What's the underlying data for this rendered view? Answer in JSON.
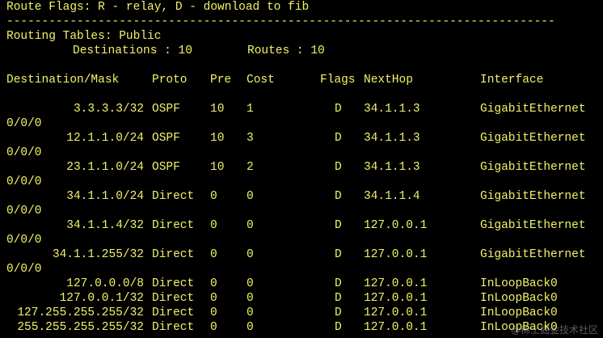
{
  "header": {
    "flags_line": "Route Flags: R - relay, D - download to fib",
    "separator": "------------------------------------------------------------------------------",
    "routing_tables": "Routing Tables: Public",
    "destinations_label": "Destinations : 10",
    "routes_label": "Routes : 10"
  },
  "columns": {
    "destination": "Destination/Mask",
    "proto": "Proto",
    "pre": "Pre",
    "cost": "Cost",
    "flags": "Flags",
    "nexthop": "NextHop",
    "interface": "Interface"
  },
  "routes": [
    {
      "dest": "3.3.3.3/32",
      "proto": "OSPF",
      "pre": "10",
      "cost": "1",
      "flags": "D",
      "nexthop": "34.1.1.3",
      "iface": "GigabitEthernet",
      "iface_cont": "0/0/0"
    },
    {
      "dest": "12.1.1.0/24",
      "proto": "OSPF",
      "pre": "10",
      "cost": "3",
      "flags": "D",
      "nexthop": "34.1.1.3",
      "iface": "GigabitEthernet",
      "iface_cont": "0/0/0"
    },
    {
      "dest": "23.1.1.0/24",
      "proto": "OSPF",
      "pre": "10",
      "cost": "2",
      "flags": "D",
      "nexthop": "34.1.1.3",
      "iface": "GigabitEthernet",
      "iface_cont": "0/0/0"
    },
    {
      "dest": "34.1.1.0/24",
      "proto": "Direct",
      "pre": "0",
      "cost": "0",
      "flags": "D",
      "nexthop": "34.1.1.4",
      "iface": "GigabitEthernet",
      "iface_cont": "0/0/0"
    },
    {
      "dest": "34.1.1.4/32",
      "proto": "Direct",
      "pre": "0",
      "cost": "0",
      "flags": "D",
      "nexthop": "127.0.0.1",
      "iface": "GigabitEthernet",
      "iface_cont": "0/0/0"
    },
    {
      "dest": "34.1.1.255/32",
      "proto": "Direct",
      "pre": "0",
      "cost": "0",
      "flags": "D",
      "nexthop": "127.0.0.1",
      "iface": "GigabitEthernet",
      "iface_cont": "0/0/0"
    },
    {
      "dest": "127.0.0.0/8",
      "proto": "Direct",
      "pre": "0",
      "cost": "0",
      "flags": "D",
      "nexthop": "127.0.0.1",
      "iface": "InLoopBack0",
      "iface_cont": ""
    },
    {
      "dest": "127.0.0.1/32",
      "proto": "Direct",
      "pre": "0",
      "cost": "0",
      "flags": "D",
      "nexthop": "127.0.0.1",
      "iface": "InLoopBack0",
      "iface_cont": ""
    },
    {
      "dest": "127.255.255.255/32",
      "proto": "Direct",
      "pre": "0",
      "cost": "0",
      "flags": "D",
      "nexthop": "127.0.0.1",
      "iface": "InLoopBack0",
      "iface_cont": ""
    },
    {
      "dest": "255.255.255.255/32",
      "proto": "Direct",
      "pre": "0",
      "cost": "0",
      "flags": "D",
      "nexthop": "127.0.0.1",
      "iface": "InLoopBack0",
      "iface_cont": ""
    }
  ],
  "watermark": "@稀土掘金技术社区",
  "colors": {
    "background": "#000000",
    "text": "#f2f26a"
  }
}
